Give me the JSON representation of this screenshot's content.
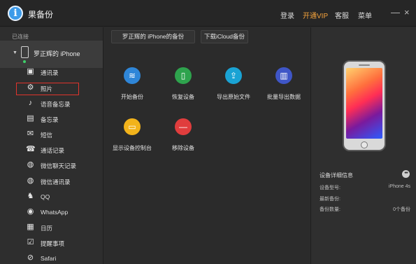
{
  "app": {
    "logo_glyph": "i",
    "title": "果备份"
  },
  "nav": {
    "login": "登录",
    "vip": "开通VIP",
    "service": "客服",
    "menu": "菜单"
  },
  "window": {
    "minimize": "—",
    "close": "×"
  },
  "sidebar": {
    "connected_label": "已连接",
    "device_name": "罗正辉的 iPhone",
    "items": [
      {
        "label": "通讯录",
        "icon": "contacts-icon",
        "glyph": "▣"
      },
      {
        "label": "照片",
        "icon": "gear-icon",
        "glyph": "⚙"
      },
      {
        "label": "语音备忘录",
        "icon": "microphone-icon",
        "glyph": "♪"
      },
      {
        "label": "备忘录",
        "icon": "notes-icon",
        "glyph": "▤"
      },
      {
        "label": "短信",
        "icon": "message-icon",
        "glyph": "✉"
      },
      {
        "label": "通话记录",
        "icon": "phone-call-icon",
        "glyph": "☎"
      },
      {
        "label": "微信聊天记录",
        "icon": "wechat-icon",
        "glyph": "◍"
      },
      {
        "label": "微信通讯录",
        "icon": "wechat-contacts-icon",
        "glyph": "◍"
      },
      {
        "label": "QQ",
        "icon": "qq-icon",
        "glyph": "♞"
      },
      {
        "label": "WhatsApp",
        "icon": "whatsapp-icon",
        "glyph": "◉"
      },
      {
        "label": "日历",
        "icon": "calendar-icon",
        "glyph": "▦"
      },
      {
        "label": "提醒事项",
        "icon": "reminder-icon",
        "glyph": "☑"
      },
      {
        "label": "Safari",
        "icon": "safari-icon",
        "glyph": "⊘"
      }
    ]
  },
  "tabs": {
    "backup": "罗正辉的 iPhone的备份",
    "icloud": "下载iCloud备份"
  },
  "actions": [
    {
      "label": "开始备份",
      "icon": "layers-icon",
      "glyph": "≋",
      "color": "#2f86d8"
    },
    {
      "label": "恢复设备",
      "icon": "phone-restore-icon",
      "glyph": "▯",
      "color": "#2ea34d"
    },
    {
      "label": "导出原始文件",
      "icon": "export-icon",
      "glyph": "⇪",
      "color": "#1aa3d4"
    },
    {
      "label": "批量导出数据",
      "icon": "batch-export-icon",
      "glyph": "▥",
      "color": "#3f56c7"
    },
    {
      "label": "显示设备控制台",
      "icon": "console-icon",
      "glyph": "▭",
      "color": "#f2b31b"
    },
    {
      "label": "移除设备",
      "icon": "remove-icon",
      "glyph": "—",
      "color": "#e03d3d"
    }
  ],
  "details": {
    "title": "设备详细信息",
    "more": "•••",
    "rows": [
      {
        "key": "设备型号:",
        "value": "iPhone 4s"
      },
      {
        "key": "最新备份:",
        "value": ""
      },
      {
        "key": "备份数量:",
        "value": "0个备份"
      }
    ]
  },
  "colors": {
    "accent_vip": "#f3a23c",
    "selection_border": "#e0342c",
    "connected_dot": "#3fd06a"
  }
}
